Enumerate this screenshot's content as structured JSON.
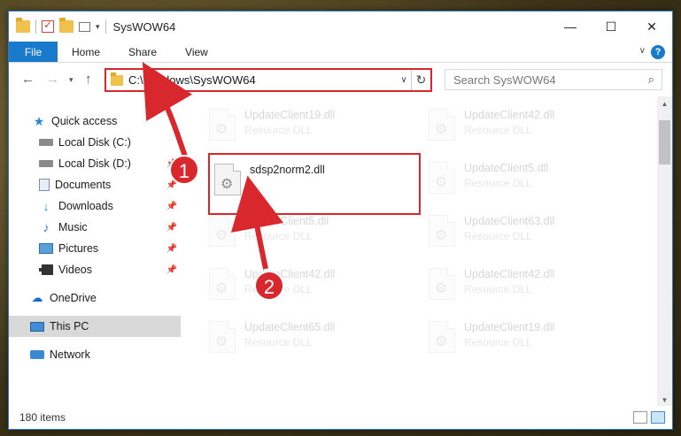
{
  "window": {
    "title": "SysWOW64",
    "controls": {
      "minimize": "—",
      "maximize": "☐",
      "close": "✕"
    }
  },
  "ribbon": {
    "tabs": [
      "File",
      "Home",
      "Share",
      "View"
    ],
    "help": "?"
  },
  "address": {
    "path": "C:\\Windows\\SysWOW64",
    "search_placeholder": "Search SysWOW64"
  },
  "sidebar": {
    "items": [
      {
        "label": "Quick access",
        "icon": "star-icon"
      },
      {
        "label": "Local Disk (C:)",
        "icon": "disk-icon"
      },
      {
        "label": "Local Disk (D:)",
        "icon": "disk-icon"
      },
      {
        "label": "Documents",
        "icon": "documents-icon"
      },
      {
        "label": "Downloads",
        "icon": "downloads-icon"
      },
      {
        "label": "Music",
        "icon": "music-icon"
      },
      {
        "label": "Pictures",
        "icon": "pictures-icon"
      },
      {
        "label": "Videos",
        "icon": "videos-icon"
      },
      {
        "label": "OneDrive",
        "icon": "cloud-icon"
      },
      {
        "label": "This PC",
        "icon": "computer-icon"
      },
      {
        "label": "Network",
        "icon": "network-icon"
      }
    ]
  },
  "files": [
    {
      "name": "UpdateClient19.dll",
      "type": "Resource DLL"
    },
    {
      "name": "UpdateClient42.dll",
      "type": "Resource DLL"
    },
    {
      "name": "sdsp2norm2.dll",
      "type": ""
    },
    {
      "name": "UpdateClient5.dll",
      "type": "Resource DLL"
    },
    {
      "name": "UpdateClient5.dll",
      "type": "Resource DLL"
    },
    {
      "name": "UpdateClient63.dll",
      "type": "Resource DLL"
    },
    {
      "name": "UpdateClient42.dll",
      "type": "Resource DLL"
    },
    {
      "name": "UpdateClient42.dll",
      "type": "Resource DLL"
    },
    {
      "name": "UpdateClient65.dll",
      "type": "Resource DLL"
    },
    {
      "name": "UpdateClient19.dll",
      "type": "Resource DLL"
    }
  ],
  "status": {
    "item_count": "180 items"
  },
  "annotations": {
    "step1": "1",
    "step2": "2",
    "color": "#d8272d"
  }
}
